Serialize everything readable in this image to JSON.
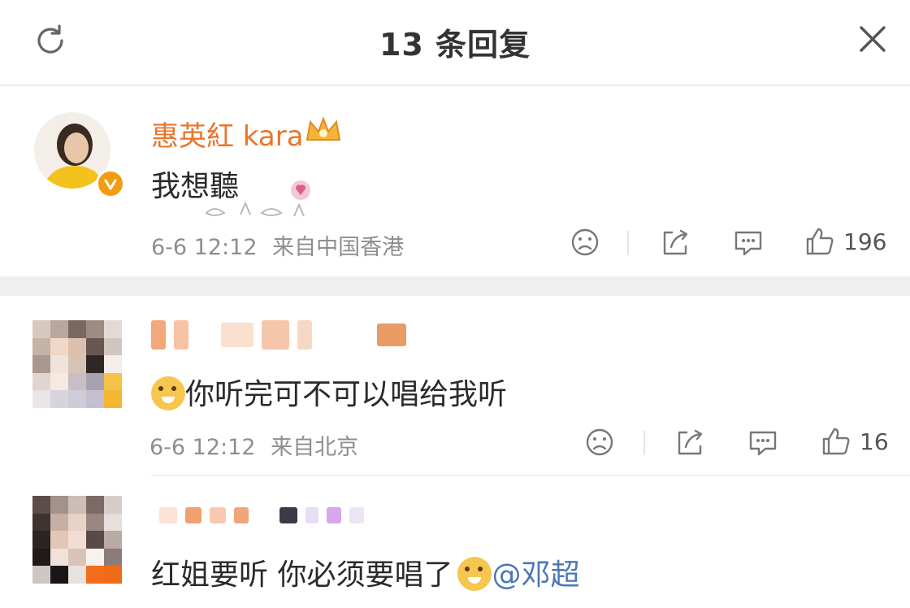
{
  "header": {
    "title": "13 条回复"
  },
  "comments": [
    {
      "name": "惠英紅 kara",
      "text": "我想聽",
      "time": "6-6 12:12",
      "location": "来自中国香港",
      "likes": "196"
    },
    {
      "name": "",
      "text": "你听完可不可以唱给我听",
      "time": "6-6 12:12",
      "location": "来自北京",
      "likes": "16"
    },
    {
      "name": "",
      "text": "红姐要听 你必须要唱了",
      "mention": "@邓超"
    }
  ],
  "icons": [
    "refresh-icon",
    "close-icon",
    "verified-badge-icon",
    "crown-badge-icon",
    "sad-face-icon",
    "share-icon",
    "comment-icon",
    "thumbs-up-icon",
    "doge-emoji-icon",
    "heart-hands-sticker-icon"
  ],
  "colors": {
    "username": "#e9742b",
    "mention": "#4b78b5",
    "meta": "#8e8e8e",
    "verified": "#f39c12"
  }
}
